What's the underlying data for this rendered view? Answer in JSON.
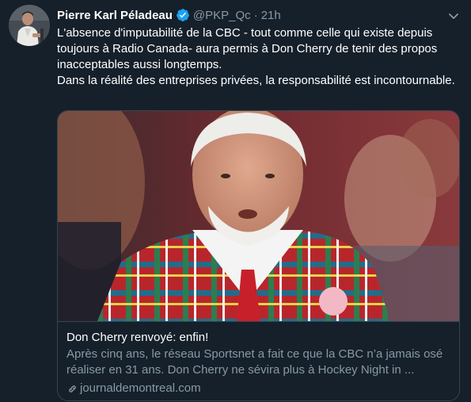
{
  "tweet": {
    "author": {
      "display_name": "Pierre Karl Péladeau",
      "handle": "@PKP_Qc",
      "verified": true
    },
    "separator": "·",
    "time": "21h",
    "text_lines": [
      "L'absence d'imputabilité de la CBC - tout comme celle qui existe depuis toujours à Radio Canada- aura permis à Don Cherry de tenir des propos inacceptables aussi longtemps.",
      "Dans la réalité des entreprises privées, la responsabilité est incontournable."
    ],
    "card": {
      "title": "Don Cherry renvoyé: enfin!",
      "description": "Après cinq ans, le réseau Sportsnet a fait ce que la CBC n’a jamais osé réaliser en 31 ans. Don Cherry ne sévira plus à Hockey Night in ...",
      "domain": "journaldemontreal.com"
    }
  },
  "icons": {
    "verified": "verified-badge-icon",
    "more": "chevron-down-icon",
    "link": "link-icon"
  },
  "colors": {
    "background": "#15202b",
    "secondary_text": "#8899a6",
    "border": "#38444d",
    "verified": "#1da1f2"
  }
}
